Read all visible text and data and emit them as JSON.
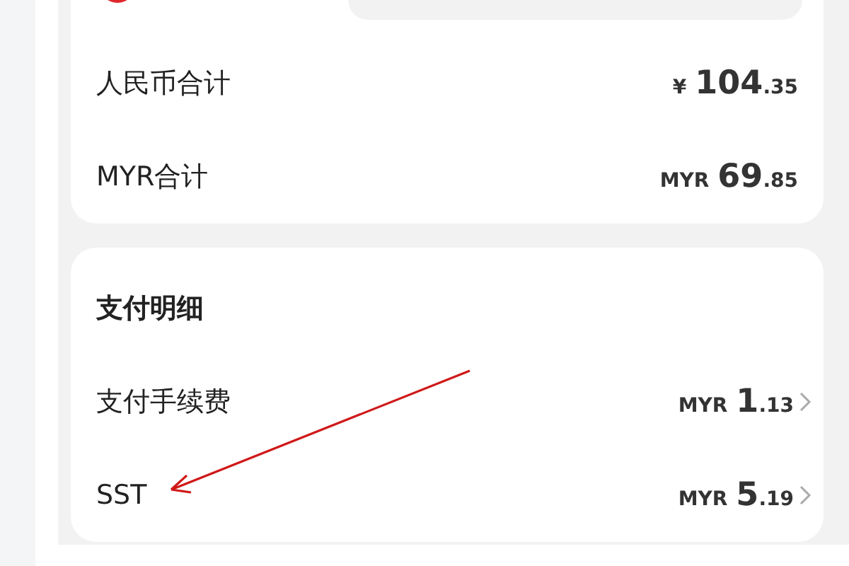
{
  "totals": [
    {
      "label": "人民币合计",
      "currency": "¥",
      "whole": "104",
      "fraction": ".35"
    },
    {
      "label": "MYR合计",
      "currency": "MYR",
      "whole": "69",
      "fraction": ".85"
    }
  ],
  "payment_details": {
    "title": "支付明细",
    "rows": [
      {
        "label": "支付手续费",
        "currency": "MYR",
        "whole": "1",
        "fraction": ".13"
      },
      {
        "label": "SST",
        "currency": "MYR",
        "whole": "5",
        "fraction": ".19"
      }
    ]
  }
}
